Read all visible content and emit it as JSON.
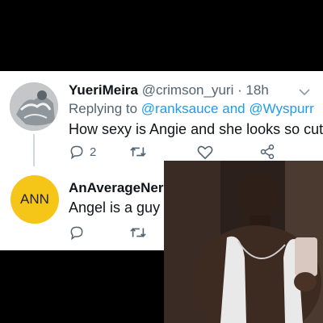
{
  "colors": {
    "background": "#000000",
    "card": "#ffffff",
    "link": "#1d9bf0",
    "muted": "#536471",
    "text": "#0f1419",
    "avatar_ann": "#f5c518"
  },
  "tweet1": {
    "display_name": "YueriMeira",
    "handle_time": "@crimson_yuri · 18h",
    "replying_prefix": "Replying to",
    "mention1": "@ranksauce",
    "joiner": "and",
    "mention2": "@Wyspurr",
    "body": "How sexy is Angie and she looks so cute",
    "reply_count": "2",
    "icons": [
      "reply-icon",
      "retweet-icon",
      "like-icon",
      "share-icon",
      "chevron-down-icon"
    ]
  },
  "tweet2": {
    "avatar_text": "ANN",
    "display_name": "AnAverageNerd",
    "body": "Angel is a guy",
    "icons": [
      "reply-icon",
      "retweet-icon"
    ]
  }
}
